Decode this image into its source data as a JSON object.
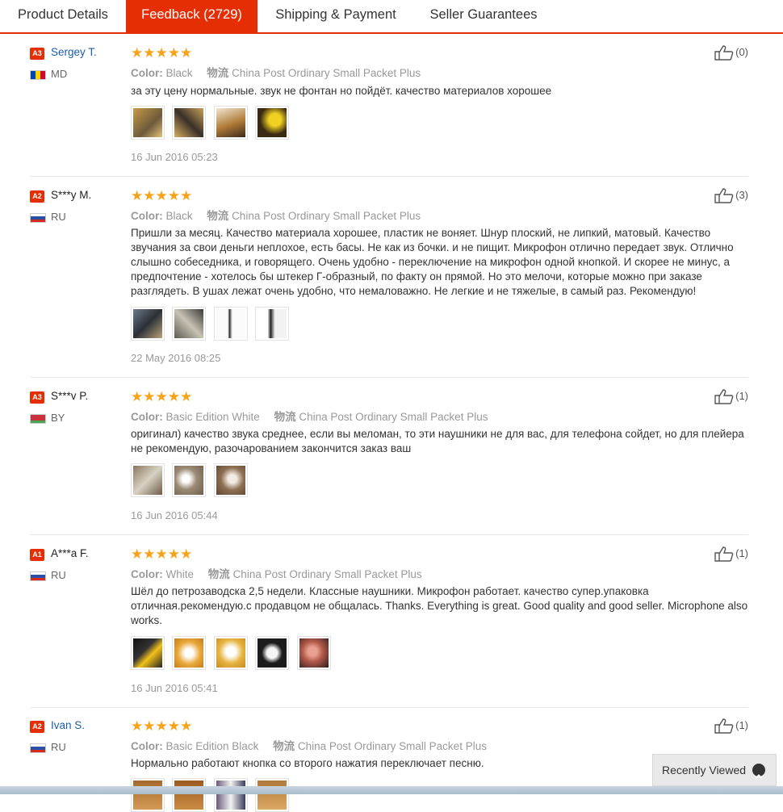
{
  "tabs": [
    {
      "label": "Product Details"
    },
    {
      "label": "Feedback (2729)"
    },
    {
      "label": "Shipping & Payment"
    },
    {
      "label": "Seller Guarantees"
    }
  ],
  "active_tab_index": 1,
  "colors": {
    "accent": "#e62e04",
    "star": "#f7a21b",
    "link": "#1a5ea8"
  },
  "reviews": [
    {
      "badge": "A3",
      "name": "Sergey T.",
      "country": "MD",
      "flag": "moldova-flag-icon",
      "stars": "★★★★★",
      "rating": 5,
      "color_label": "Color:",
      "color": "Black",
      "shipping_icon": "物流",
      "shipping": "China Post Ordinary Small Packet Plus",
      "text": "за эту цену нормальные. звук не фонтан но пойдёт. качество материалов хорошее",
      "date": "16 Jun 2016 05:23",
      "likes": "(0)",
      "photos": 4
    },
    {
      "badge": "A2",
      "name": "S***y M.",
      "country": "RU",
      "flag": "russia-flag-icon",
      "stars": "★★★★★",
      "rating": 5,
      "color_label": "Color:",
      "color": "Black",
      "shipping_icon": "物流",
      "shipping": "China Post Ordinary Small Packet Plus",
      "text": "Пришли за месяц. Качество материала хорошее, пластик не воняет. Шнур плоский, не липкий, матовый. Качество звучания за свои деньги неплохое, есть басы. Не как из бочки. и не пищит. Микрофон отлично передает звук. Отлично слышно собеседника, и говорящего. Очень удобно - переключение на микрофон одной кнопкой. И скорее не минус, а предпочтение - хотелось бы штекер Г-образный, по факту он прямой. Но это мелочи, которые можно при заказе разглядеть. В ушах лежат очень удобно, что немаловажно. Не легкие и не тяжелые, в самый раз. Рекомендую!",
      "date": "22 May 2016 08:25",
      "likes": "(3)",
      "photos": 4
    },
    {
      "badge": "A3",
      "name": "S***v P.",
      "country": "BY",
      "flag": "belarus-flag-icon",
      "stars": "★★★★★",
      "rating": 5,
      "color_label": "Color:",
      "color": "Basic Edition White",
      "shipping_icon": "物流",
      "shipping": "China Post Ordinary Small Packet Plus",
      "text": "оригинал) качество звука среднее, если вы меломан, то эти наушники не для вас, для телефона сойдет, но для плейера не рекомендую, разочарованием закончится заказ ваш",
      "date": "16 Jun 2016 05:44",
      "likes": "(1)",
      "photos": 3
    },
    {
      "badge": "A1",
      "name": "A***a F.",
      "country": "RU",
      "flag": "russia-flag-icon",
      "stars": "★★★★★",
      "rating": 5,
      "color_label": "Color:",
      "color": "White",
      "shipping_icon": "物流",
      "shipping": "China Post Ordinary Small Packet Plus",
      "text": "Шёл до петрозаводска 2,5 недели. Классные наушники. Микрофон работает. качество супер.упаковка отличная.рекомендую.с продавцом не общалась. Thanks. Everything is great. Good quality and good seller. Microphone also works.",
      "date": "16 Jun 2016 05:41",
      "likes": "(1)",
      "photos": 5
    },
    {
      "badge": "A2",
      "name": "Ivan S.",
      "country": "RU",
      "flag": "russia-flag-icon",
      "stars": "★★★★★",
      "rating": 5,
      "color_label": "Color:",
      "color": "Basic Edition Black",
      "shipping_icon": "物流",
      "shipping": "China Post Ordinary Small Packet Plus",
      "text": "Нормально работают кнопка со второго нажатия переключает песню.",
      "date": "",
      "likes": "(1)",
      "photos": 4
    }
  ],
  "recently_viewed": {
    "label": "Recently Viewed",
    "icon": "chevron-up-icon"
  }
}
